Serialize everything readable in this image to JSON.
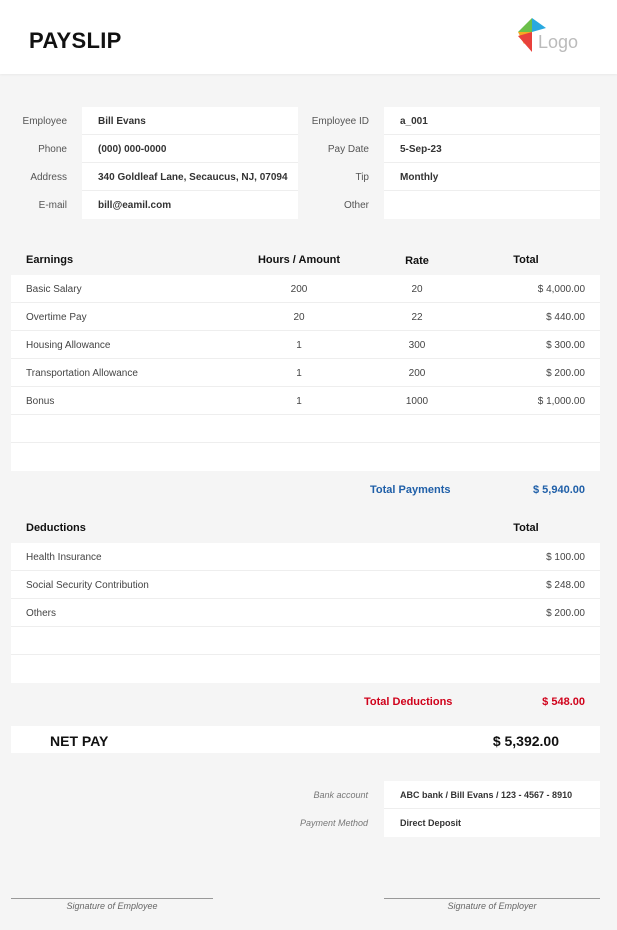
{
  "header": {
    "title": "PAYSLIP",
    "logo_text": "Logo"
  },
  "employee": {
    "left_labels": [
      "Employee",
      "Phone",
      "Address",
      "E-mail"
    ],
    "left_values": [
      "Bill Evans",
      "(000) 000-0000",
      "340 Goldleaf Lane, Secaucus, NJ, 07094",
      "bill@eamil.com"
    ],
    "right_labels": [
      "Employee ID",
      "Pay Date",
      "Tip",
      "Other"
    ],
    "right_values": [
      "a_001",
      "5-Sep-23",
      "Monthly",
      ""
    ]
  },
  "earnings": {
    "headers": {
      "name": "Earnings",
      "hours": "Hours / Amount",
      "rate": "Rate",
      "total": "Total"
    },
    "rows": [
      {
        "name": "Basic Salary",
        "hours": "200",
        "rate": "20",
        "total": "$ 4,000.00"
      },
      {
        "name": "Overtime Pay",
        "hours": "20",
        "rate": "22",
        "total": "$ 440.00"
      },
      {
        "name": "Housing Allowance",
        "hours": "1",
        "rate": "300",
        "total": "$ 300.00"
      },
      {
        "name": "Transportation Allowance",
        "hours": "1",
        "rate": "200",
        "total": "$ 200.00"
      },
      {
        "name": "Bonus",
        "hours": "1",
        "rate": "1000",
        "total": "$ 1,000.00"
      },
      {
        "name": "",
        "hours": "",
        "rate": "",
        "total": ""
      },
      {
        "name": "",
        "hours": "",
        "rate": "",
        "total": ""
      }
    ],
    "total_label": "Total Payments",
    "total_value": "$ 5,940.00"
  },
  "deductions": {
    "headers": {
      "name": "Deductions",
      "total": "Total"
    },
    "rows": [
      {
        "name": "Health Insurance",
        "total": "$ 100.00"
      },
      {
        "name": "Social Security Contribution",
        "total": "$ 248.00"
      },
      {
        "name": "Others",
        "total": "$ 200.00"
      },
      {
        "name": "",
        "total": ""
      },
      {
        "name": "",
        "total": ""
      }
    ],
    "total_label": "Total Deductions",
    "total_value": "$ 548.00"
  },
  "net_pay": {
    "label": "NET PAY",
    "value": "$ 5,392.00"
  },
  "payment": {
    "bank_label": "Bank account",
    "bank_value": "ABC bank / Bill Evans / 123 - 4567 - 8910",
    "method_label": "Payment Method",
    "method_value": "Direct Deposit"
  },
  "signatures": {
    "employee": "Signature of Employee",
    "employer": "Signature of Employer"
  },
  "colors": {
    "accent_blue": "#1f5fa8",
    "accent_red": "#d0021b",
    "background": "#f5f5f5"
  }
}
